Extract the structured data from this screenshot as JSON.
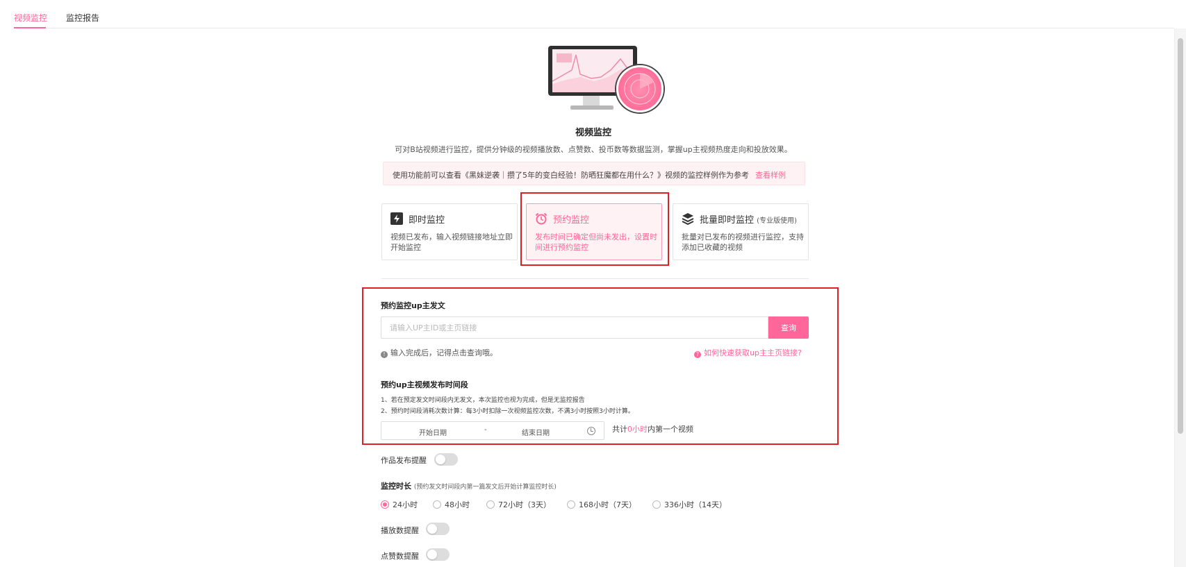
{
  "tabs": [
    {
      "label": "视频监控",
      "active": true
    },
    {
      "label": "监控报告",
      "active": false
    }
  ],
  "header": {
    "title": "视频监控",
    "description": "可对B站视频进行监控，提供分钟级的视频播放数、点赞数、投币数等数据监测，掌握up主视频热度走向和投放效果。"
  },
  "notice": {
    "text": "使用功能前可以查看《黑妹逆袭｜攒了5年的变白经验！防晒狂魔都在用什么？》视频的监控样例作为参考",
    "link": "查看样例"
  },
  "modes": [
    {
      "icon": "lightning-icon",
      "title": "即时监控",
      "tag": "",
      "desc": "视频已发布，输入视频链接地址立即开始监控",
      "selected": false
    },
    {
      "icon": "alarm-clock-icon",
      "title": "预约监控",
      "tag": "",
      "desc": "发布时间已确定但尚未发出，设置时间进行预约监控",
      "selected": true
    },
    {
      "icon": "layers-icon",
      "title": "批量即时监控",
      "tag": "(专业版使用)",
      "desc": "批量对已发布的视频进行监控，支持添加已收藏的视频",
      "selected": false
    }
  ],
  "form": {
    "up_section_title": "预约监控up主发文",
    "up_input_placeholder": "请输入UP主ID或主页链接",
    "up_input_value": "",
    "query_button": "查询",
    "hint": "输入完成后，记得点击查询哦。",
    "help_link": "如何快速获取up主主页链接?",
    "time_section_title": "预约up主视频发布时间段",
    "rules": [
      "1、若在预定发文时间段内无发文，本次监控也视为完成，但是无监控报告",
      "2、预约时间段消耗次数计算：每3小时扣除一次视频监控次数，不满3小时按照3小时计算。"
    ],
    "date_start_placeholder": "开始日期",
    "date_separator": "-",
    "date_end_placeholder": "结束日期",
    "total_prefix": "共计",
    "total_hours": "0小时",
    "total_suffix": "内第一个视频",
    "publish_alert_label": "作品发布提醒",
    "publish_alert_on": false,
    "duration_label": "监控时长",
    "duration_note": "(预约发文时间段内第一篇发文后开始计算监控时长)",
    "duration_options": [
      {
        "label": "24小时",
        "checked": true
      },
      {
        "label": "48小时",
        "checked": false
      },
      {
        "label": "72小时（3天）",
        "checked": false
      },
      {
        "label": "168小时（7天）",
        "checked": false
      },
      {
        "label": "336小时（14天）",
        "checked": false
      }
    ],
    "play_alert_label": "播放数提醒",
    "play_alert_on": false,
    "like_alert_label": "点赞数提醒",
    "like_alert_on": false
  },
  "colors": {
    "accent": "#ff6699",
    "highlight_border": "#e02020"
  }
}
